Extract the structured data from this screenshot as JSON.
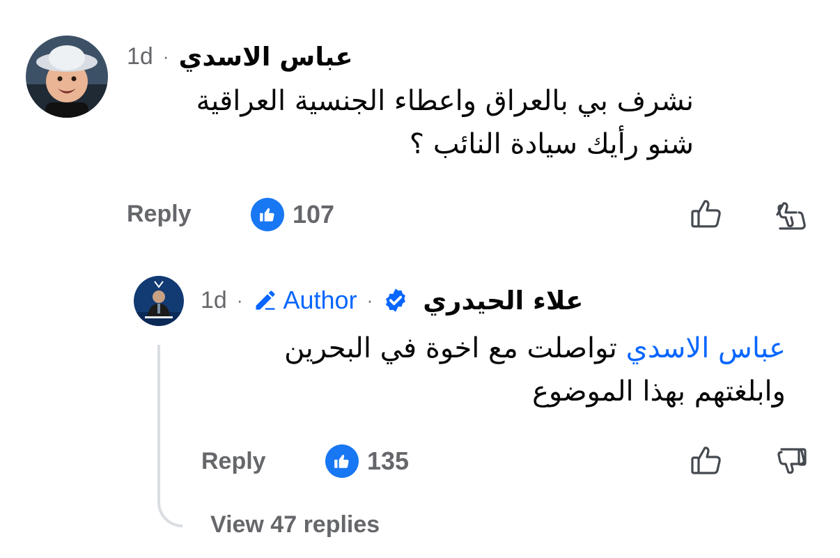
{
  "comment": {
    "author": "عباس  الاسدي",
    "time": "1d",
    "separator": "·",
    "text_lines": [
      "نشرف بي بالعراق واعطاء الجنسية العراقية",
      "شنو رأيك سيادة النائب ؟"
    ],
    "reply_label": "Reply",
    "like_count": "107"
  },
  "reply": {
    "author": "علاء  الحيدري",
    "time": "1d",
    "separator": "·",
    "author_badge": "Author",
    "mention": "عباس الاسدي",
    "text_line1_rest": " تواصلت مع اخوة في البحرين",
    "text_line2": "وابلغتهم بهذا الموضوع",
    "reply_label": "Reply",
    "like_count": "135"
  },
  "view_replies_label": "View 47 replies",
  "colors": {
    "link_blue": "#0866ff",
    "like_blue": "#1877f2",
    "secondary_text": "#65676b",
    "thread_line": "#dadde1"
  },
  "icons": {
    "like": "thumbs-up-icon",
    "dislike": "thumbs-down-icon",
    "verified": "verified-badge-icon",
    "author": "pencil-icon"
  }
}
